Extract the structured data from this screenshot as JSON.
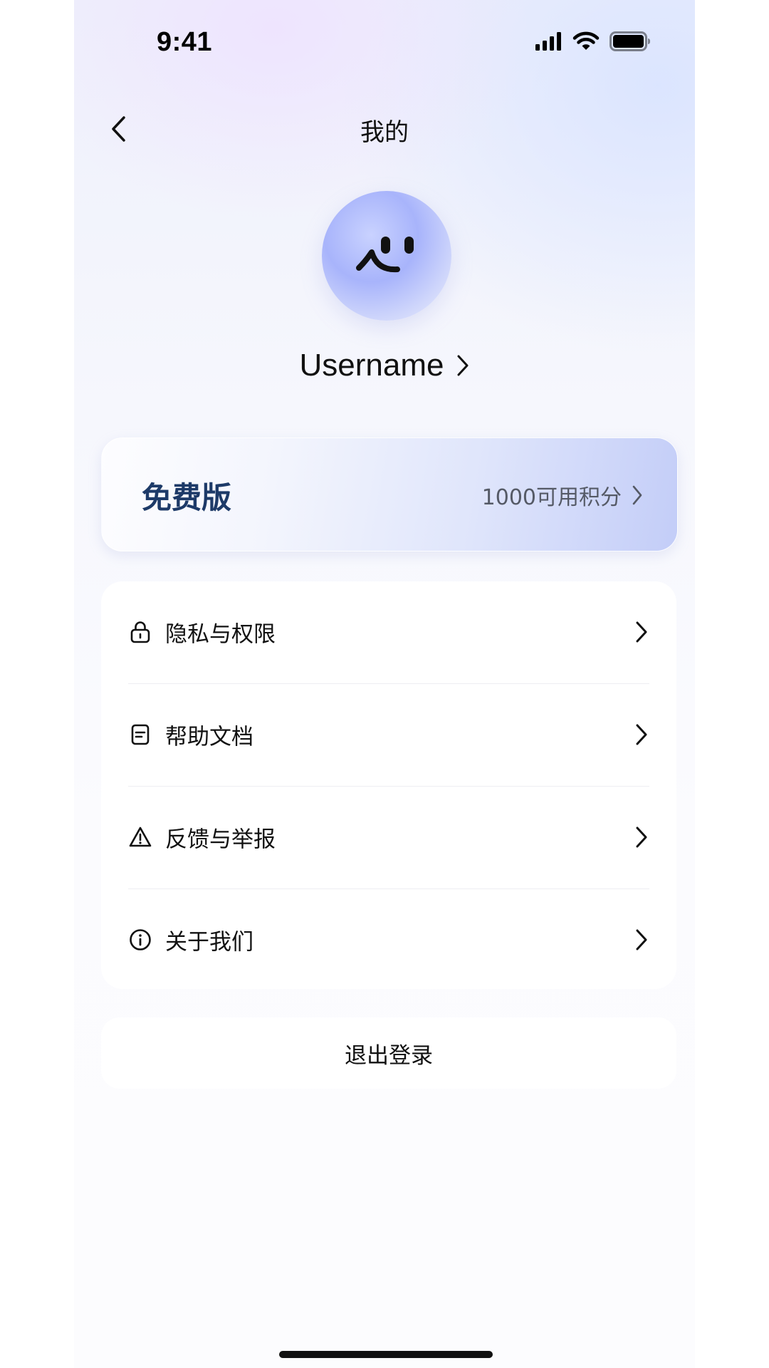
{
  "status_bar": {
    "time": "9:41",
    "icons": [
      "cellular-signal-icon",
      "wifi-icon",
      "battery-icon"
    ]
  },
  "nav": {
    "back_icon": "chevron-left-icon",
    "title": "我的"
  },
  "profile": {
    "avatar_icon": "smiley-face-avatar",
    "username": "Username"
  },
  "plan": {
    "name": "免费版",
    "points": "1000可用积分",
    "name_color": "#1d3a68"
  },
  "menu": {
    "items": [
      {
        "label": "隐私与权限",
        "icon": "lock-icon"
      },
      {
        "label": "帮助文档",
        "icon": "document-icon"
      },
      {
        "label": "反馈与举报",
        "icon": "warning-icon"
      },
      {
        "label": "关于我们",
        "icon": "info-icon"
      }
    ]
  },
  "logout": {
    "label": "退出登录"
  }
}
